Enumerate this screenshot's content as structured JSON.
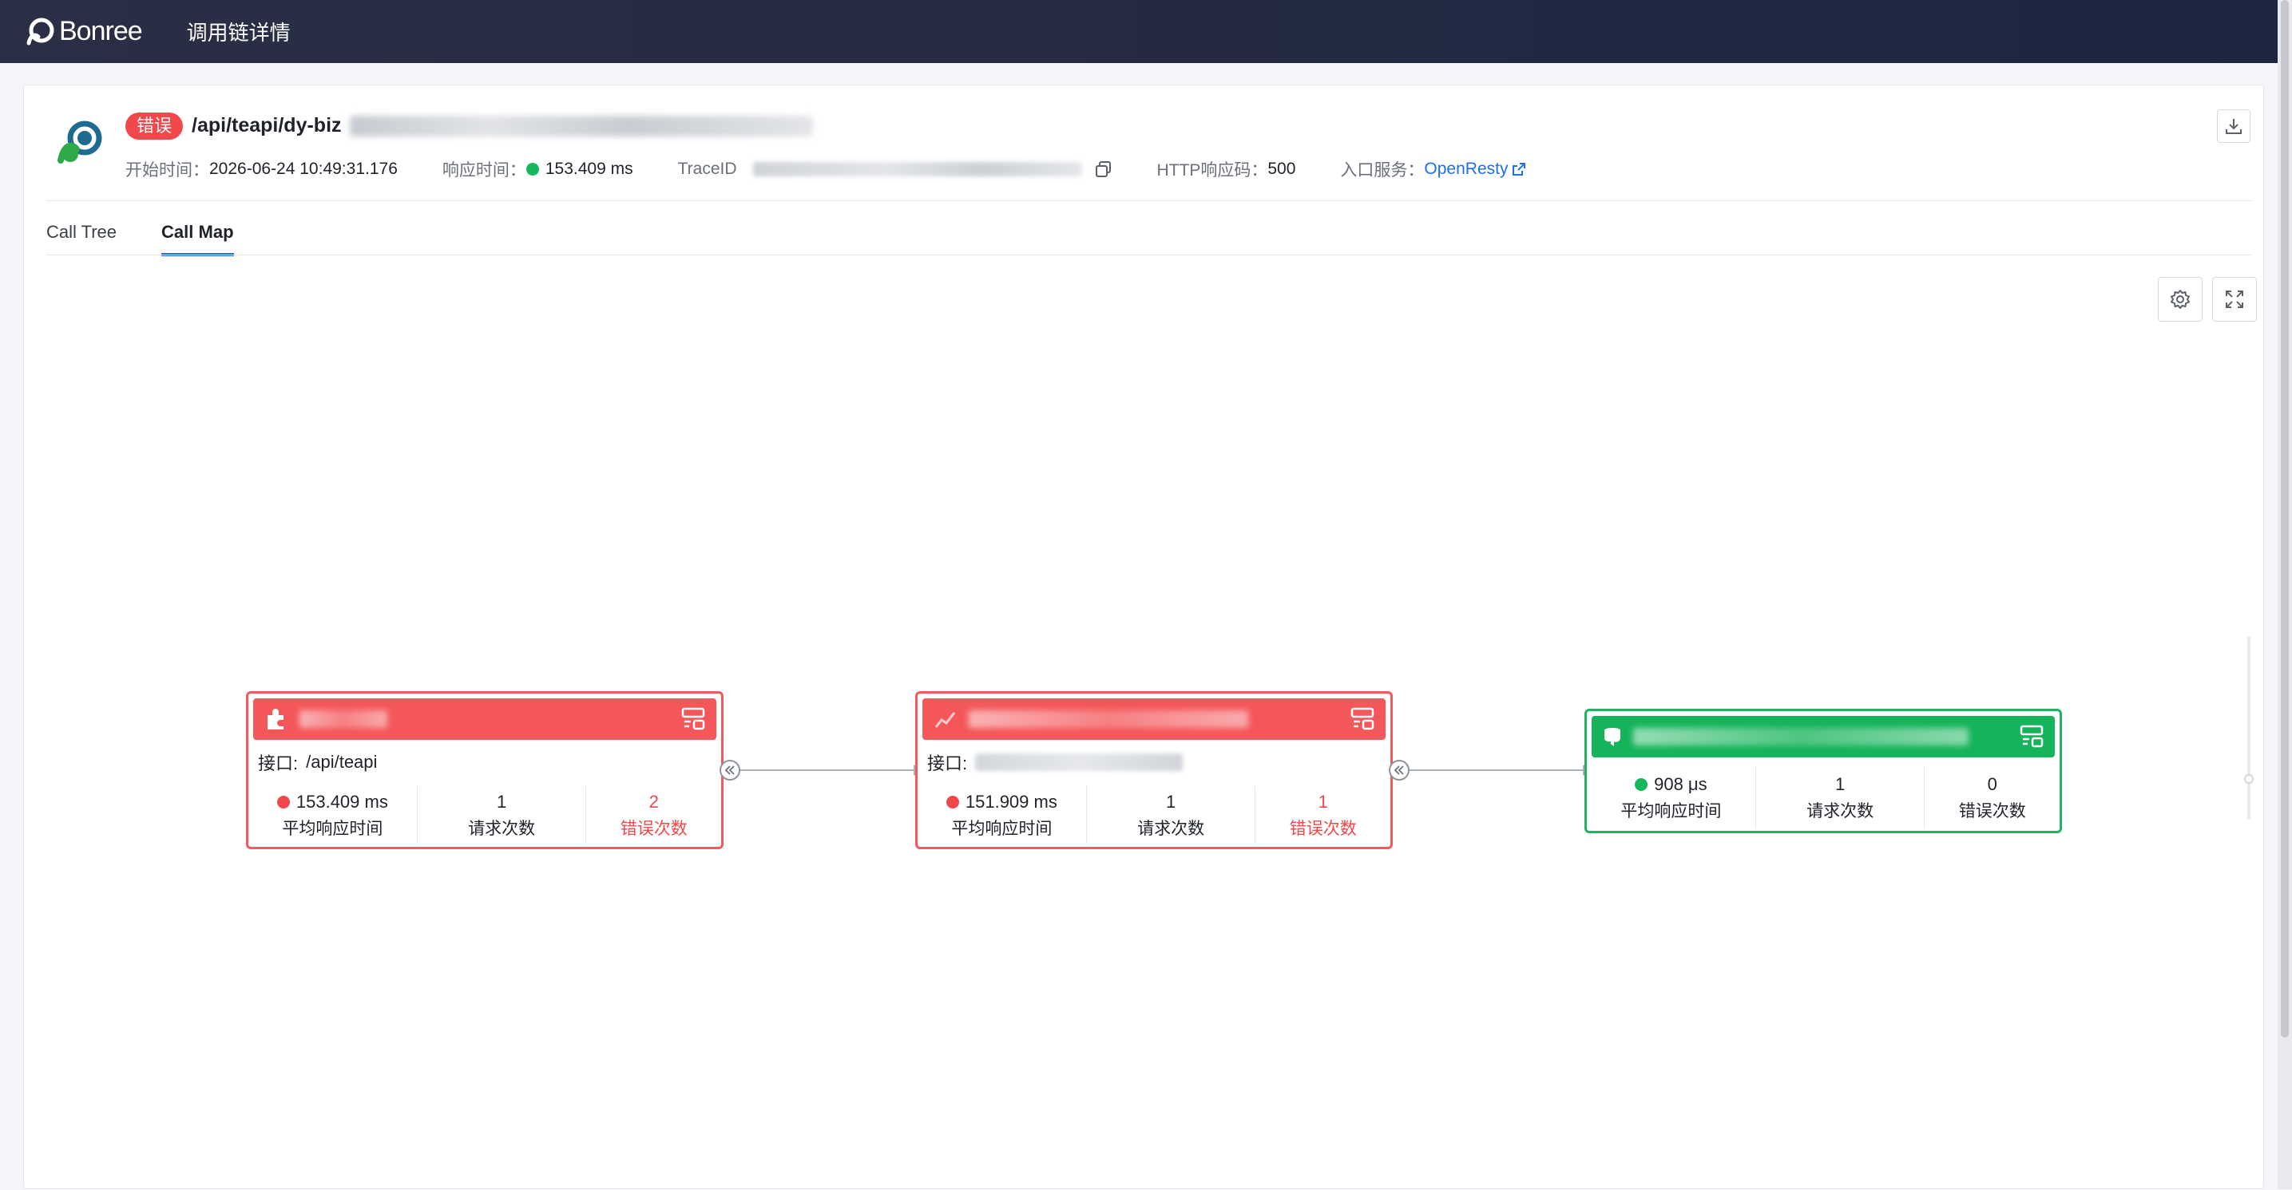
{
  "topbar": {
    "brand": "Bonree",
    "title": "调用链详情"
  },
  "header": {
    "status_tag": "错误",
    "api_path": "/api/teapi/dy-biz",
    "meta": {
      "start_label": "开始时间：",
      "start_value": "2026-06-24 10:49:31.176",
      "resp_label": "响应时间：",
      "resp_value": "153.409 ms",
      "trace_label": "TraceID",
      "http_label": "HTTP响应码：",
      "http_value": "500",
      "entry_label": "入口服务：",
      "entry_value": "OpenResty"
    }
  },
  "tabs": [
    {
      "label": "Call Tree",
      "active": false
    },
    {
      "label": "Call Map",
      "active": true
    }
  ],
  "nodes": [
    {
      "status": "error",
      "interface_label": "接口:",
      "interface_value": "/api/teapi",
      "stats": [
        {
          "value": "153.409 ms",
          "label": "平均响应时间"
        },
        {
          "value": "1",
          "label": "请求次数"
        },
        {
          "value": "2",
          "label": "错误次数"
        }
      ]
    },
    {
      "status": "error",
      "interface_label": "接口:",
      "stats": [
        {
          "value": "151.909 ms",
          "label": "平均响应时间"
        },
        {
          "value": "1",
          "label": "请求次数"
        },
        {
          "value": "1",
          "label": "错误次数"
        }
      ]
    },
    {
      "status": "ok",
      "stats": [
        {
          "value": "908 μs",
          "label": "平均响应时间"
        },
        {
          "value": "1",
          "label": "请求次数"
        },
        {
          "value": "0",
          "label": "错误次数"
        }
      ]
    }
  ],
  "colors": {
    "error": "#f4575a",
    "ok": "#15b35a",
    "accent": "#1f6fe5",
    "topbar": "#232a42"
  }
}
